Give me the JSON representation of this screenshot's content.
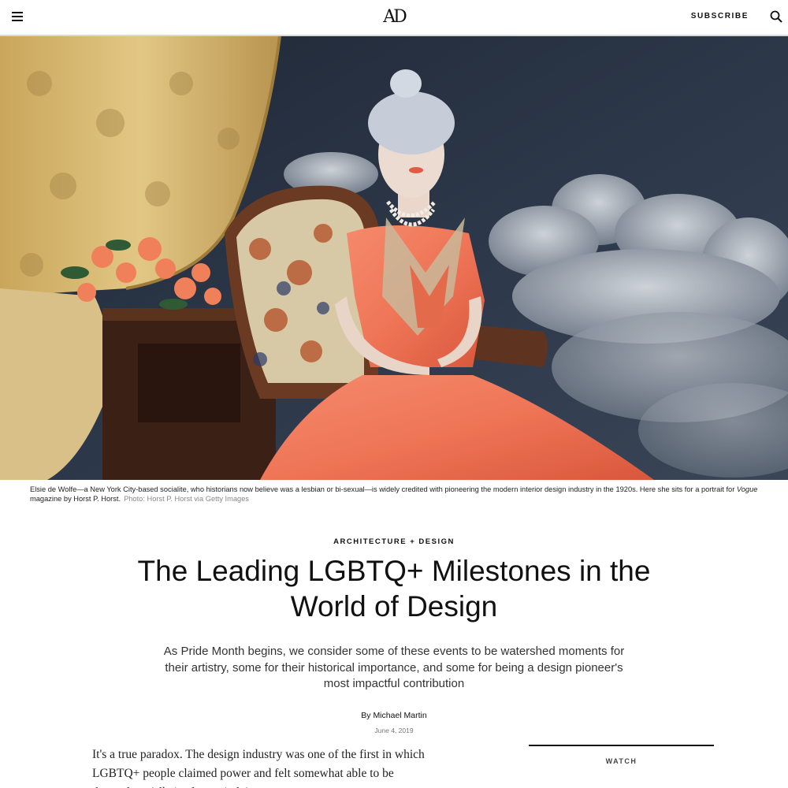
{
  "header": {
    "logo": "AD",
    "subscribe_label": "SUBSCRIBE"
  },
  "hero": {
    "caption_text_1": "Elsie de Wolfe—a New York City-based socialite, who historians now believe was a lesbian or bi-sexual—is widely credited with pioneering the modern interior design industry in the 1920s. Here she sits for a portrait for ",
    "caption_italic": "Vogue",
    "caption_text_2": " magazine by Horst P. Horst.",
    "caption_credit": "Photo: Horst P. Horst via Getty Images"
  },
  "article": {
    "rubric": "ARCHITECTURE + DESIGN",
    "headline": "The Leading LGBTQ+ Milestones in the World of Design",
    "dek": "As Pride Month begins, we consider some of these events to be watershed moments for their artistry, some for their historical importance, and some for being a design pioneer's most impactful contribution",
    "byline_prefix": "By ",
    "author": "Michael Martin",
    "date": "June 4, 2019",
    "body_paragraph": "It's a true paradox. The design industry was one of the first in which LGBTQ+ people claimed power and felt somewhat able to be themselves (albeit often quietly)."
  },
  "sidebar": {
    "watch_label": "WATCH"
  },
  "colors": {
    "dress": "#f07a5c",
    "curtain": "#d6b56a",
    "backdrop": "#2c3646",
    "clouds": "#b9c0c8",
    "wood": "#3b2016"
  }
}
